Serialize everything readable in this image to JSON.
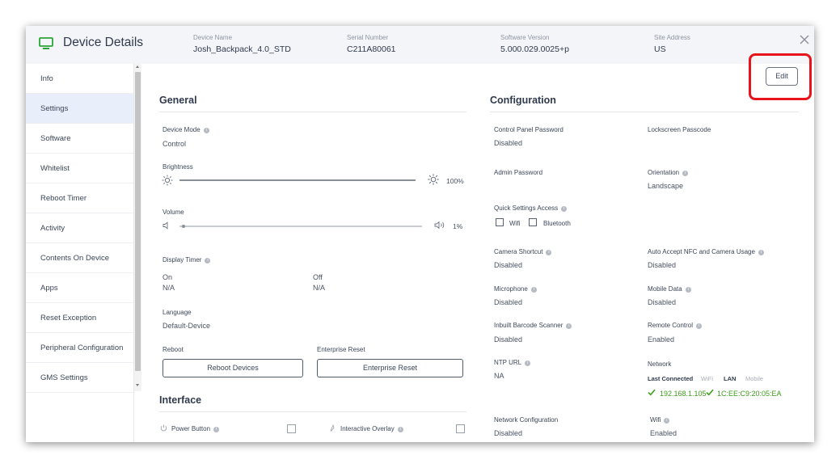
{
  "header": {
    "title": "Device Details",
    "device_name": {
      "label": "Device Name",
      "value": "Josh_Backpack_4.0_STD"
    },
    "serial_number": {
      "label": "Serial Number",
      "value": "C211A80061"
    },
    "software_version": {
      "label": "Software Version",
      "value": "5.000.029.0025+p"
    },
    "site_address": {
      "label": "Site Address",
      "value": "US"
    }
  },
  "sidebar": {
    "active": "Settings",
    "items": [
      "Info",
      "Settings",
      "Software",
      "Whitelist",
      "Reboot Timer",
      "Activity",
      "Contents On Device",
      "Apps",
      "Reset Exception",
      "Peripheral Configuration",
      "GMS Settings"
    ]
  },
  "edit_label": "Edit",
  "general": {
    "title": "General",
    "device_mode": {
      "label": "Device Mode",
      "value": "Control"
    },
    "brightness": {
      "label": "Brightness",
      "value": "100%",
      "level": 1.0
    },
    "volume": {
      "label": "Volume",
      "value": "1%",
      "level": 0.01
    },
    "display_timer": {
      "label": "Display Timer",
      "on_label": "On",
      "on_value": "N/A",
      "off_label": "Off",
      "off_value": "N/A"
    },
    "language": {
      "label": "Language",
      "value": "Default-Device"
    },
    "reboot": {
      "label": "Reboot",
      "button": "Reboot Devices"
    },
    "enterprise_reset": {
      "label": "Enterprise Reset",
      "button": "Enterprise Reset"
    }
  },
  "interface": {
    "title": "Interface",
    "power_button": "Power Button",
    "interactive_overlay": "Interactive Overlay"
  },
  "configuration": {
    "title": "Configuration",
    "control_panel_password": {
      "label": "Control Panel Password",
      "value": "Disabled"
    },
    "lockscreen_passcode": {
      "label": "Lockscreen Passcode",
      "value": ""
    },
    "admin_password": {
      "label": "Admin Password",
      "value": ""
    },
    "orientation": {
      "label": "Orientation",
      "value": "Landscape"
    },
    "quick_settings_access": {
      "label": "Quick Settings Access",
      "wifi": "Wifi",
      "bluetooth": "Bluetooth"
    },
    "camera_shortcut": {
      "label": "Camera Shortcut",
      "value": "Disabled"
    },
    "auto_accept_nfc": {
      "label": "Auto Accept NFC and Camera Usage",
      "value": "Disabled"
    },
    "microphone": {
      "label": "Microphone",
      "value": "Disabled"
    },
    "mobile_data": {
      "label": "Mobile Data",
      "value": "Disabled"
    },
    "inbuilt_barcode_scanner": {
      "label": "Inbuilt Barcode Scanner",
      "value": "Disabled"
    },
    "remote_control": {
      "label": "Remote Control",
      "value": "Enabled"
    },
    "ntp_url": {
      "label": "NTP URL",
      "value": "NA"
    },
    "network": {
      "label": "Network",
      "last_connected": "Last Connected",
      "tabs": [
        "WiFi",
        "LAN",
        "Mobile"
      ],
      "active_tab": "LAN",
      "ip": "192.168.1.105",
      "mac": "1C:EE:C9:20:05:EA"
    },
    "network_configuration": {
      "label": "Network Configuration",
      "value": "Disabled"
    },
    "wifi": {
      "label": "Wifi",
      "value": "Enabled"
    }
  },
  "colors": {
    "accent": "#2ca437",
    "highlight": "#e8141b",
    "active_nav": "#e9eefb"
  }
}
